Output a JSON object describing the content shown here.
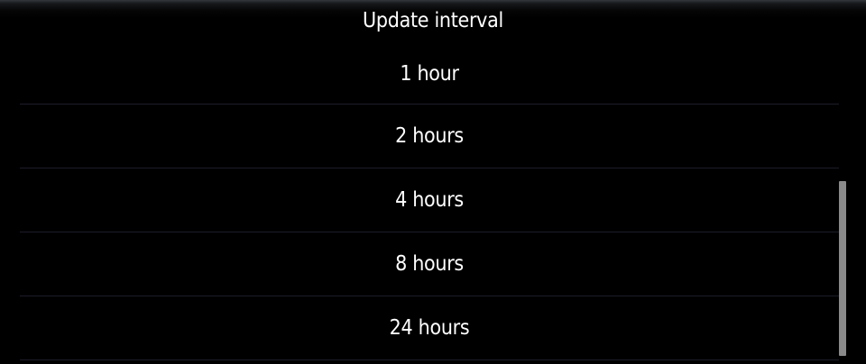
{
  "dialog": {
    "title": "Update interval",
    "options": [
      {
        "label": "1 hour"
      },
      {
        "label": "2 hours"
      },
      {
        "label": "4 hours"
      },
      {
        "label": "8 hours"
      },
      {
        "label": "24 hours"
      }
    ]
  },
  "colors": {
    "background": "#000000",
    "text": "#ffffff",
    "divider": "#1c1d2a",
    "scrollbar": "#8a8a8a"
  }
}
